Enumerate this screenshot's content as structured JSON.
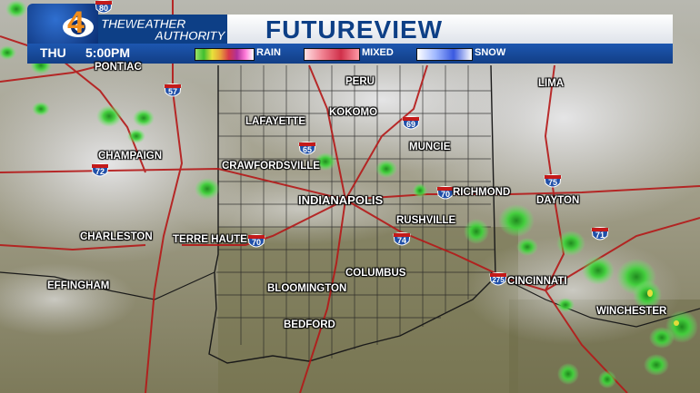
{
  "header": {
    "logo_number": "4",
    "brand_line1": "THEWEATHER",
    "brand_line2": "AUTHORITY",
    "title": "FUTUREVIEW",
    "day": "THU",
    "time": "5:00PM"
  },
  "legend": [
    {
      "label": "RAIN"
    },
    {
      "label": "MIXED"
    },
    {
      "label": "SNOW"
    }
  ],
  "colors": {
    "brand_blue": "#0d3f86",
    "logo_orange": "#f08c1a",
    "radar_green": "#3fd13a",
    "highway_red": "#b51818",
    "interstate_blue": "#1f4fa8"
  },
  "cities": [
    {
      "name": "PONTIAC"
    },
    {
      "name": "PERU"
    },
    {
      "name": "LIMA"
    },
    {
      "name": "LAFAYETTE"
    },
    {
      "name": "KOKOMO"
    },
    {
      "name": "MUNCIE"
    },
    {
      "name": "CHAMPAIGN"
    },
    {
      "name": "CRAWFORDSVILLE"
    },
    {
      "name": "INDIANAPOLIS"
    },
    {
      "name": "RICHMOND"
    },
    {
      "name": "DAYTON"
    },
    {
      "name": "RUSHVILLE"
    },
    {
      "name": "CHARLESTON"
    },
    {
      "name": "TERRE HAUTE"
    },
    {
      "name": "COLUMBUS"
    },
    {
      "name": "CINCINNATI"
    },
    {
      "name": "EFFINGHAM"
    },
    {
      "name": "BLOOMINGTON"
    },
    {
      "name": "WINCHESTER"
    },
    {
      "name": "BEDFORD"
    }
  ],
  "interstates": [
    "80",
    "57",
    "72",
    "65",
    "69",
    "70",
    "75",
    "74",
    "70",
    "71",
    "275"
  ]
}
